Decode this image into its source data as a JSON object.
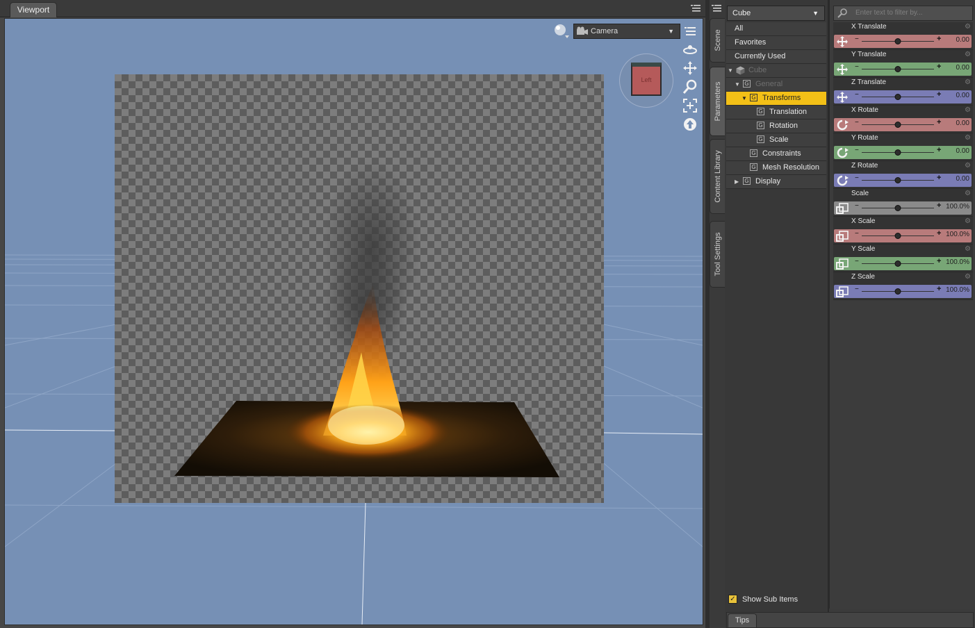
{
  "viewport": {
    "tab_label": "Viewport",
    "camera_label": "Camera",
    "view_cube_label": "Left",
    "tools": [
      "orbit-icon",
      "pan-icon",
      "zoom-icon",
      "frame-icon",
      "reset-icon"
    ]
  },
  "side_tabs": [
    "Scene",
    "Parameters",
    "Content Library",
    "Tool Settings"
  ],
  "tree": {
    "node_select": "Cube",
    "rows": [
      {
        "label": "All"
      },
      {
        "label": "Favorites"
      },
      {
        "label": "Currently Used"
      },
      {
        "label": "Cube"
      },
      {
        "label": "General"
      },
      {
        "label": "Transforms"
      },
      {
        "label": "Translation"
      },
      {
        "label": "Rotation"
      },
      {
        "label": "Scale"
      },
      {
        "label": "Constraints"
      },
      {
        "label": "Mesh Resolution"
      },
      {
        "label": "Display"
      }
    ],
    "group_glyph": "G",
    "show_sub_items": "Show Sub Items",
    "tips_label": "Tips"
  },
  "params": {
    "search_placeholder": "Enter text to filter by...",
    "items": [
      {
        "name": "X Translate",
        "value": "0.00",
        "color": "red",
        "kind": "translate",
        "level": 0.5
      },
      {
        "name": "Y Translate",
        "value": "0.00",
        "color": "green",
        "kind": "translate",
        "level": 0.5
      },
      {
        "name": "Z Translate",
        "value": "0.00",
        "color": "blue",
        "kind": "translate",
        "level": 0.5
      },
      {
        "name": "X Rotate",
        "value": "0.00",
        "color": "red",
        "kind": "rotate",
        "level": 0.5
      },
      {
        "name": "Y Rotate",
        "value": "0.00",
        "color": "green",
        "kind": "rotate",
        "level": 0.5
      },
      {
        "name": "Z Rotate",
        "value": "0.00",
        "color": "blue",
        "kind": "rotate",
        "level": 0.5
      },
      {
        "name": "Scale",
        "value": "100.0%",
        "color": "gray",
        "kind": "scale",
        "level": 0.5
      },
      {
        "name": "X Scale",
        "value": "100.0%",
        "color": "red",
        "kind": "scale",
        "level": 0.5
      },
      {
        "name": "Y Scale",
        "value": "100.0%",
        "color": "green",
        "kind": "scale",
        "level": 0.5
      },
      {
        "name": "Z Scale",
        "value": "100.0%",
        "color": "blue",
        "kind": "scale",
        "level": 0.5
      }
    ]
  },
  "colors": {
    "selection": "#f3c017",
    "viewport_bg": "#7690b5",
    "red_channel": "#b87b7b",
    "green_channel": "#78a676",
    "blue_channel": "#7a7cb5"
  }
}
